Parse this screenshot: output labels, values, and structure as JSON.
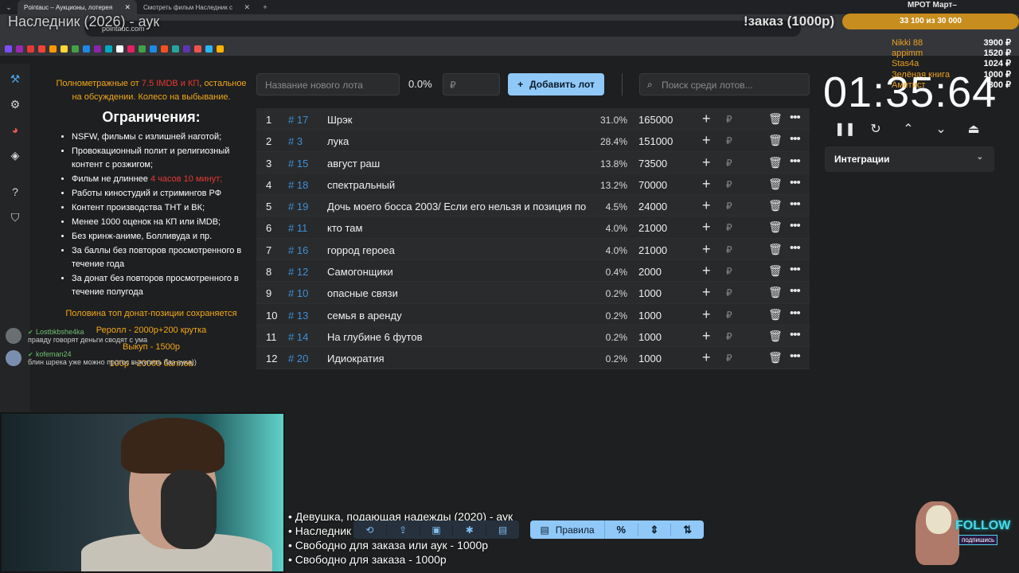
{
  "browser": {
    "tabs": [
      {
        "label": "Pointauc – Аукционы, лотерея",
        "active": true
      },
      {
        "label": "Смотреть фильм Наследник с",
        "active": false
      }
    ],
    "url": "pointauc.com"
  },
  "overlay": {
    "stream_title": "Наследник (2026) - аук",
    "order_label": "!заказ (1000р)",
    "goal_text": "33 100  из 30 000",
    "mrot_label": "МРОТ Март–",
    "donors": [
      {
        "name": "Nikki 88",
        "amount": "3900 ₽"
      },
      {
        "name": "appimm",
        "amount": "1520 ₽"
      },
      {
        "name": "Stas4a",
        "amount": "1024 ₽"
      },
      {
        "name": "Зелёная книга",
        "amount": "1000 ₽"
      },
      {
        "name": "Аметист",
        "amount": "800 ₽"
      }
    ]
  },
  "rules": {
    "intro_1": "Полнометражные от ",
    "intro_red": "7.5 IMDB и КП",
    "intro_2": ", остальное на обсуждении. Колесо на выбывание.",
    "heading": "Ограничения:",
    "items": [
      "NSFW, фильмы с излишней наготой;",
      "Провокационный полит и религиозный контент с розжигом;",
      "Фильм не длиннее ",
      "Работы киностудий и стримингов РФ",
      "Контент производства ТНТ и ВК;",
      "Менее 1000 оценок на КП или iMDB;",
      "Без кринж-аниме, Болливуда и пр.",
      "За баллы без повторов просмотренного в течение года",
      "За донат без повторов просмотренного в течение полугода"
    ],
    "length_red": "4 часов 10 минут;",
    "bottom": [
      "Половина топ донат-позиции сохраняется",
      "Реролл - 2000р+200 крутка",
      "Выкуп - 1500р",
      "100р - 20000 баллов"
    ]
  },
  "chat": [
    {
      "nick": "Lostbkbshe4ka",
      "text": "правду говорят деньги сводят с ума"
    },
    {
      "nick": "kofeman24",
      "text": "блин шрека уже можно протос выкупить баз аука))"
    }
  ],
  "controls": {
    "new_lot_placeholder": "Название нового лота",
    "percent": "0.0%",
    "currency_placeholder": "₽",
    "add_label": "Добавить лот",
    "search_placeholder": "Поиск среди лотов..."
  },
  "lots": [
    {
      "n": "1",
      "id": "# 17",
      "name": "Шрэк",
      "pct": "31.0%",
      "amount": "165000"
    },
    {
      "n": "2",
      "id": "# 3",
      "name": "лука",
      "pct": "28.4%",
      "amount": "151000"
    },
    {
      "n": "3",
      "id": "# 15",
      "name": "август раш",
      "pct": "13.8%",
      "amount": "73500"
    },
    {
      "n": "4",
      "id": "# 18",
      "name": "спектральный",
      "pct": "13.2%",
      "amount": "70000"
    },
    {
      "n": "5",
      "id": "# 19",
      "name": "Дочь моего босса 2003/ Если его нельзя и позиция по",
      "pct": "4.5%",
      "amount": "24000"
    },
    {
      "n": "6",
      "id": "# 11",
      "name": "кто там",
      "pct": "4.0%",
      "amount": "21000"
    },
    {
      "n": "7",
      "id": "# 16",
      "name": "горрод героеа",
      "pct": "4.0%",
      "amount": "21000"
    },
    {
      "n": "8",
      "id": "# 12",
      "name": "Самогонщики",
      "pct": "0.4%",
      "amount": "2000"
    },
    {
      "n": "9",
      "id": "# 10",
      "name": "опасные связи",
      "pct": "0.2%",
      "amount": "1000"
    },
    {
      "n": "10",
      "id": "# 13",
      "name": "семья в аренду",
      "pct": "0.2%",
      "amount": "1000"
    },
    {
      "n": "11",
      "id": "# 14",
      "name": "На глубине 6 футов",
      "pct": "0.2%",
      "amount": "1000"
    },
    {
      "n": "12",
      "id": "# 20",
      "name": "Идиократия",
      "pct": "0.2%",
      "amount": "1000"
    }
  ],
  "lot_row": {
    "rub": "₽"
  },
  "timer": {
    "value": "01:35:64"
  },
  "integrations": {
    "label": "Интеграции"
  },
  "queue": [
    "• Девушка, подающая надежды (2020) - аук",
    "• Наследник (2026) - аук",
    "• Свободно для заказа или аук - 1000р",
    "• Свободно для заказа - 1000р"
  ],
  "bottom_bar": {
    "rules_label": "Правила",
    "pct_label": "%"
  },
  "follow": {
    "title": "FOLLOW",
    "sub": "подпишись"
  }
}
